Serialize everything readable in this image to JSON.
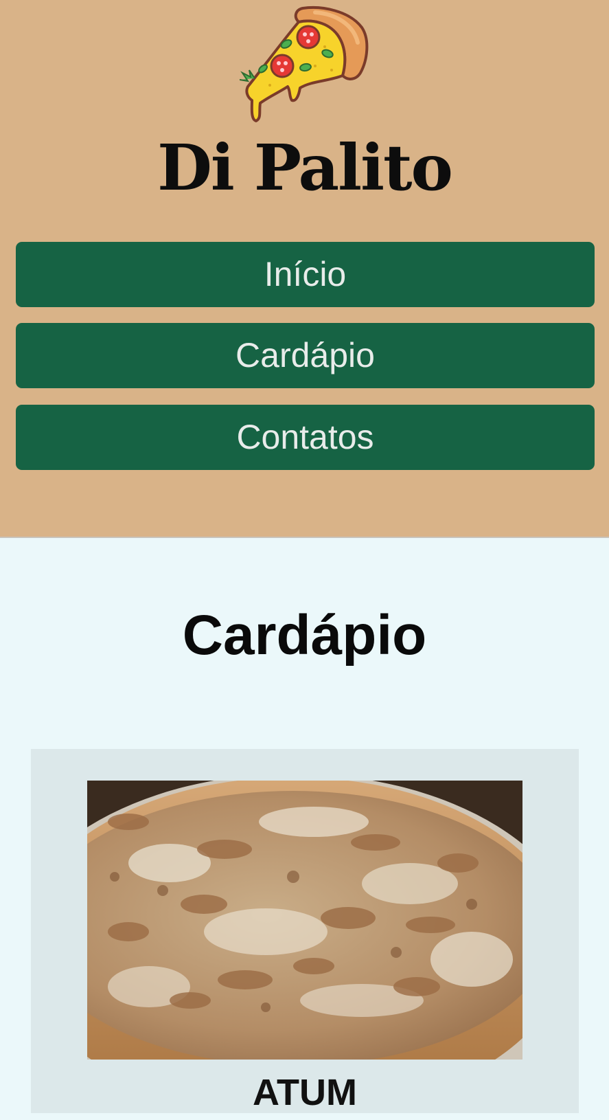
{
  "header": {
    "logo_icon": "pizza-slice-icon",
    "brand": "Di Palito",
    "colors": {
      "background": "#d9b388",
      "nav_button": "#166344",
      "nav_text": "#e8ecea"
    }
  },
  "nav": {
    "items": [
      {
        "label": "Início"
      },
      {
        "label": "Cardápio"
      },
      {
        "label": "Contatos"
      }
    ]
  },
  "menu": {
    "title": "Cardápio",
    "items": [
      {
        "name": "ATUM",
        "image": "tuna-pizza-photo"
      }
    ]
  }
}
